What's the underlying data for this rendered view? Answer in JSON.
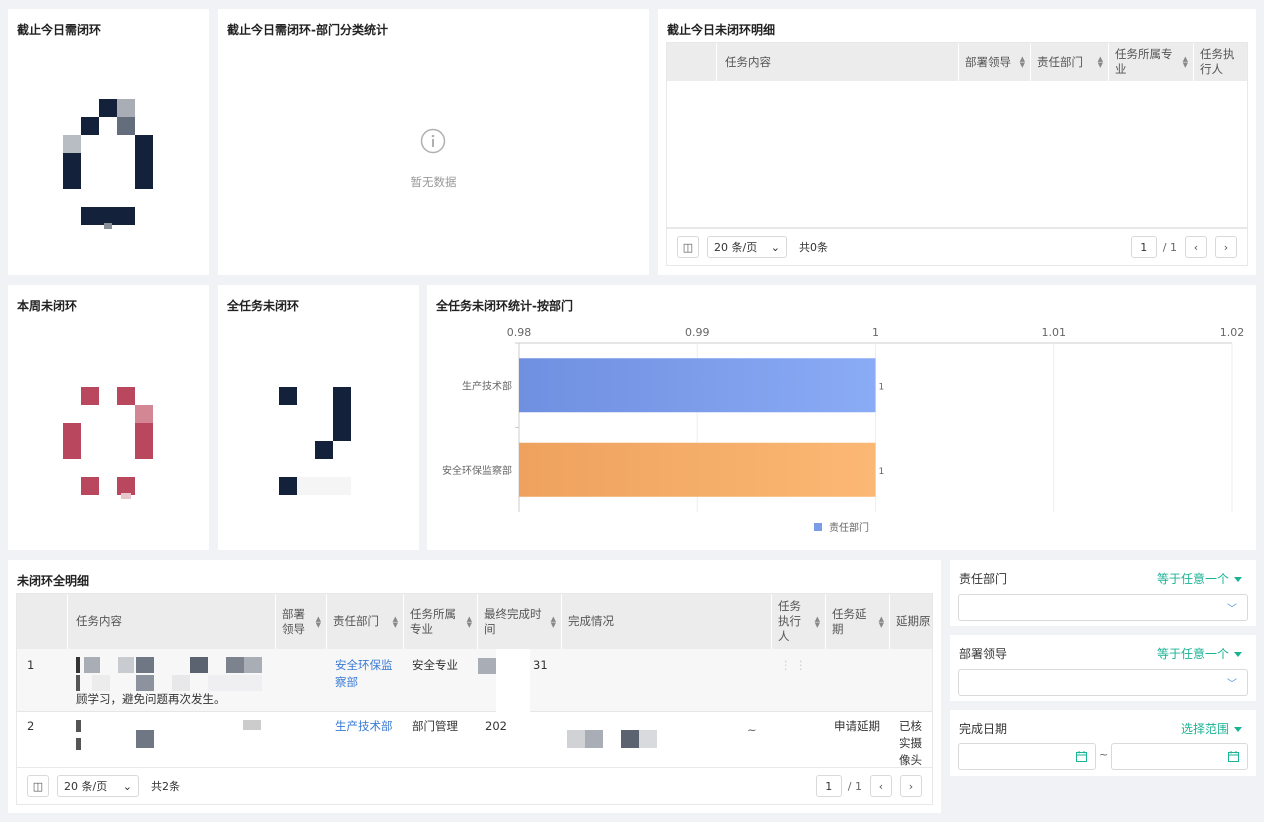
{
  "panels": {
    "today_need_close": {
      "title": "截止今日需闭环"
    },
    "today_dept_stats": {
      "title": "截止今日需闭环-部门分类统计",
      "empty_text": "暂无数据"
    },
    "today_unclosed_detail": {
      "title": "截止今日未闭环明细",
      "columns": [
        "任务内容",
        "部署领导",
        "责任部门",
        "任务所属专业",
        "任务执行人"
      ],
      "page_size": "20 条/页",
      "total": "共0条",
      "page_current": "1",
      "page_total": "/ 1"
    },
    "week_unclosed": {
      "title": "本周未闭环"
    },
    "all_unclosed": {
      "title": "全任务未闭环"
    },
    "all_unclosed_by_dept": {
      "title": "全任务未闭环统计-按部门"
    },
    "all_unclosed_detail": {
      "title": "未闭环全明细",
      "columns": [
        "任务内容",
        "部署领导",
        "责任部门",
        "任务所属专业",
        "最终完成时间",
        "完成情况",
        "任务执行人",
        "任务延期",
        "延期原"
      ],
      "rows": [
        {
          "index": "1",
          "content_line3": "顾学习，避免问题再次发生。",
          "dept": "安全环保监察部",
          "major": "安全专业",
          "time_tail": "31",
          "delay": "",
          "reason": ""
        },
        {
          "index": "2",
          "content_line3": "",
          "dept": "生产技术部",
          "major": "部门管理",
          "time_tail": "202",
          "delay": "申请延期",
          "reason": "已核实摄像头"
        }
      ],
      "page_size": "20 条/页",
      "total": "共2条",
      "page_current": "1",
      "page_total": "/ 1"
    }
  },
  "filters": [
    {
      "label": "责任部门",
      "op": "等于任意一个",
      "kind": "select"
    },
    {
      "label": "部署领导",
      "op": "等于任意一个",
      "kind": "select"
    },
    {
      "label": "完成日期",
      "op": "选择范围",
      "kind": "daterange",
      "sep": "~"
    }
  ],
  "chart_data": {
    "type": "bar",
    "orientation": "horizontal",
    "categories": [
      "生产技术部",
      "安全环保监察部"
    ],
    "series": [
      {
        "name": "责任部门",
        "values": [
          1,
          1
        ],
        "colors": [
          "#7b9de6",
          "#f4a96a"
        ]
      }
    ],
    "xlim": [
      0.98,
      1.02
    ],
    "xticks": [
      "0.98",
      "0.99",
      "1",
      "1.01",
      "1.02"
    ],
    "data_labels": [
      "1",
      "1"
    ],
    "legend": "bottom-center",
    "grid": true
  },
  "colors": {
    "accent": "#1ab394",
    "link": "#3a7bd5",
    "navy": "#14213a",
    "red": "#b9485e"
  }
}
